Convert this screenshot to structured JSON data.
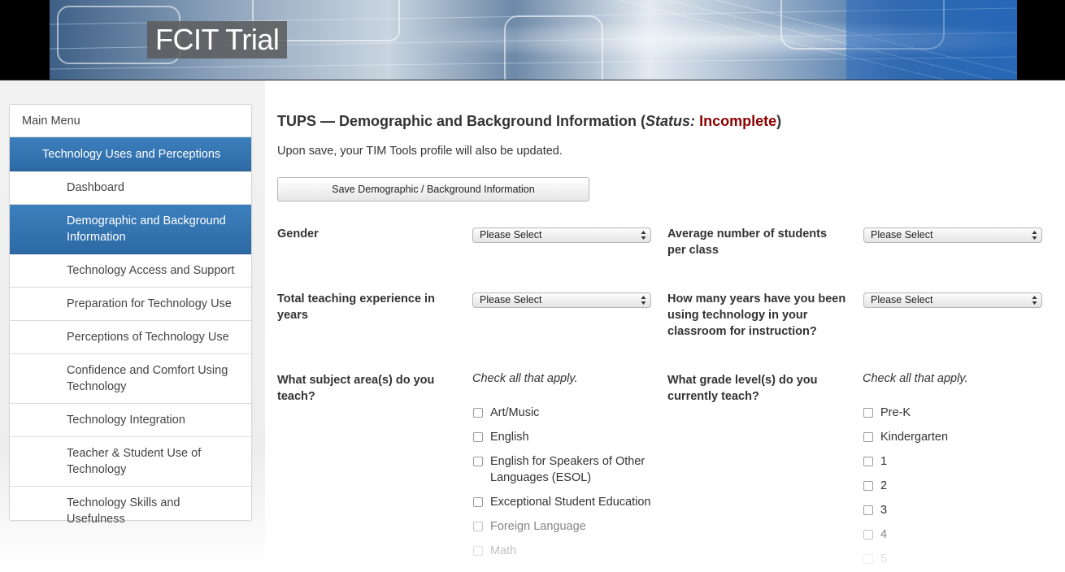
{
  "header": {
    "site_title": "FCIT Trial"
  },
  "sidebar": {
    "main_menu": "Main Menu",
    "section": "Technology Uses and Perceptions",
    "items": [
      {
        "label": "Dashboard"
      },
      {
        "label": "Demographic and Background Information",
        "active": true
      },
      {
        "label": "Technology Access and Support"
      },
      {
        "label": "Preparation for Technology Use"
      },
      {
        "label": "Perceptions of Technology Use"
      },
      {
        "label": "Confidence and Comfort Using Technology"
      },
      {
        "label": "Technology Integration"
      },
      {
        "label": "Teacher & Student Use of Technology"
      },
      {
        "label": "Technology Skills and Usefulness"
      }
    ]
  },
  "main": {
    "title_prefix": "TUPS — Demographic and Background Information (",
    "status_word": "Status:",
    "status_value": "Incomplete",
    "title_suffix": ")",
    "save_note": "Upon save, your TIM Tools profile will also be updated.",
    "save_button": "Save Demographic / Background Information",
    "select_placeholder": "Please Select",
    "questions": {
      "gender": "Gender",
      "avg_students": "Average number of students per class",
      "teaching_experience": "Total teaching experience in years",
      "years_tech": "How many years have you been using technology in your classroom for instruction?",
      "subject_areas": "What subject area(s) do you teach?",
      "grade_levels": "What grade level(s) do you currently teach?"
    },
    "check_all_hint": "Check all that apply.",
    "subjects": [
      "Art/Music",
      "English",
      "English for Speakers of Other Languages (ESOL)",
      "Exceptional Student Education",
      "Foreign Language",
      "Math"
    ],
    "grades": [
      "Pre-K",
      "Kindergarten",
      "1",
      "2",
      "3",
      "4",
      "5"
    ]
  },
  "colors": {
    "menu_active": "#2d6aa5",
    "status_incomplete": "#8b0000",
    "header_bg": "#000000"
  }
}
